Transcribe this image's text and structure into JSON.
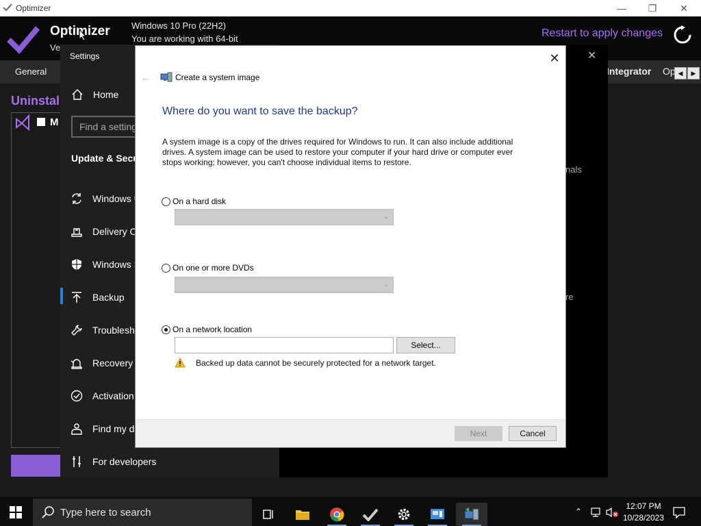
{
  "optimizer": {
    "window_title": "Optimizer",
    "app_name": "Optimizer",
    "version_prefix": "Ve",
    "windows_version": "Windows 10 Pro (22H2)",
    "bitness": "You are working with 64-bit",
    "restart_label": "Restart to apply changes",
    "tabs": {
      "general": "General",
      "integrator": "Integrator",
      "op": "Op"
    },
    "uninstall_title": "Uninstal",
    "list_letter": "M",
    "accent_color": "#a66ff0"
  },
  "settings": {
    "title": "Settings",
    "home": "Home",
    "search_placeholder": "Find a setting",
    "section": "Update & Secu",
    "items": [
      {
        "label": "Windows U",
        "icon": "sync-icon"
      },
      {
        "label": "Delivery O",
        "icon": "delivery-icon"
      },
      {
        "label": "Windows S",
        "icon": "shield-icon"
      },
      {
        "label": "Backup",
        "icon": "backup-arrow-icon"
      },
      {
        "label": "Troublesho",
        "icon": "wrench-icon"
      },
      {
        "label": "Recovery",
        "icon": "recovery-icon"
      },
      {
        "label": "Activation",
        "icon": "activation-check-icon"
      },
      {
        "label": "Find my de",
        "icon": "person-pin-icon"
      },
      {
        "label": "For developers",
        "icon": "developer-icon"
      }
    ],
    "right_fragments": {
      "nals": "nals",
      "re": "re"
    }
  },
  "dialog": {
    "breadcrumb": "Create a system image",
    "heading": "Where do you want to save the backup?",
    "description": "A system image is a copy of the drives required for Windows to run. It can also include additional drives. A system image can be used to restore your computer if your hard drive or computer ever stops working; however, you can't choose individual items to restore.",
    "options": {
      "hard_disk": "On a hard disk",
      "dvds": "On one or more DVDs",
      "network": "On a network location"
    },
    "selected_option": "network",
    "network_value": "",
    "select_button": "Select...",
    "warning": "Backed up data cannot be securely protected for a network target.",
    "next_button": "Next",
    "cancel_button": "Cancel"
  },
  "taskbar": {
    "search_placeholder": "Type here to search",
    "time": "12:07 PM",
    "date": "10/28/2023"
  }
}
